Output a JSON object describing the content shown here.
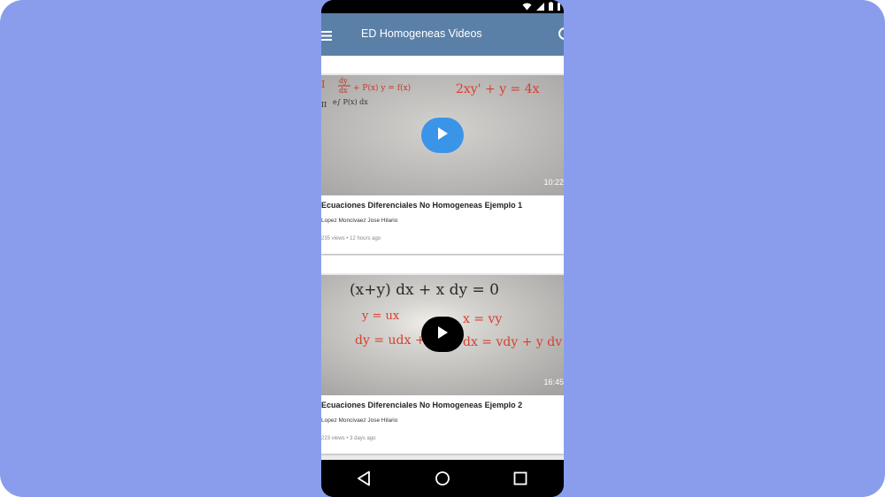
{
  "app": {
    "title": "ED Homogeneas Videos"
  },
  "colors": {
    "backdrop": "#8a9ded",
    "app_bar": "#5b80a8",
    "play_blue": "#3a95e8",
    "play_black": "#000000"
  },
  "icons": {
    "menu": "hamburger-menu-icon",
    "search": "search-icon",
    "wifi": "wifi-icon",
    "signal": "signal-icon",
    "battery": "battery-icon",
    "back": "nav-back-icon",
    "home": "nav-home-icon",
    "recents": "nav-recents-icon"
  },
  "videos": [
    {
      "title": "Ecuaciones Diferenciales No Homogeneas Ejemplo 1",
      "channel": "Lopez Moncivaez Jose Hilario",
      "meta": "235 views • 12 hours ago",
      "duration": "10:22",
      "board_text": [
        "I",
        "dy",
        "dx",
        "+ P(x) y = f(x)",
        "2xy' + y = 4x",
        "II",
        "e∫ P(x) dx"
      ]
    },
    {
      "title": "Ecuaciones Diferenciales No Homogeneas Ejemplo 2",
      "channel": "Lopez Moncivaez Jose Hilario",
      "meta": "223 views • 3 days ago",
      "duration": "16:45",
      "board_text": [
        "(x+y) dx + x dy = 0",
        "y = ux",
        "x = vy",
        "dy = udx +",
        "dx = vdy + y dv"
      ]
    }
  ]
}
